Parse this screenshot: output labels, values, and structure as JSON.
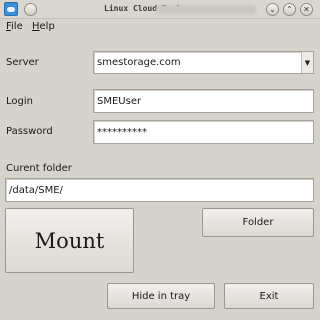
{
  "window": {
    "title": "Linux Cloud Tools",
    "buttons": {
      "minimize": "⌄",
      "maximize": "⌃",
      "close": "✕"
    }
  },
  "menu": {
    "items": [
      "File",
      "Help"
    ]
  },
  "form": {
    "server_label": "Server",
    "server_value": "smestorage.com",
    "login_label": "Login",
    "login_value": "SMEUser",
    "password_label": "Password",
    "password_value": "**********",
    "folder_label": "Curent folder",
    "folder_value": "/data/SME/"
  },
  "buttons": {
    "folder": "Folder",
    "mount": "Mount",
    "hide": "Hide in tray",
    "exit": "Exit"
  },
  "icons": {
    "app": "cloud-app-icon",
    "combo": "chevron-down-icon"
  }
}
